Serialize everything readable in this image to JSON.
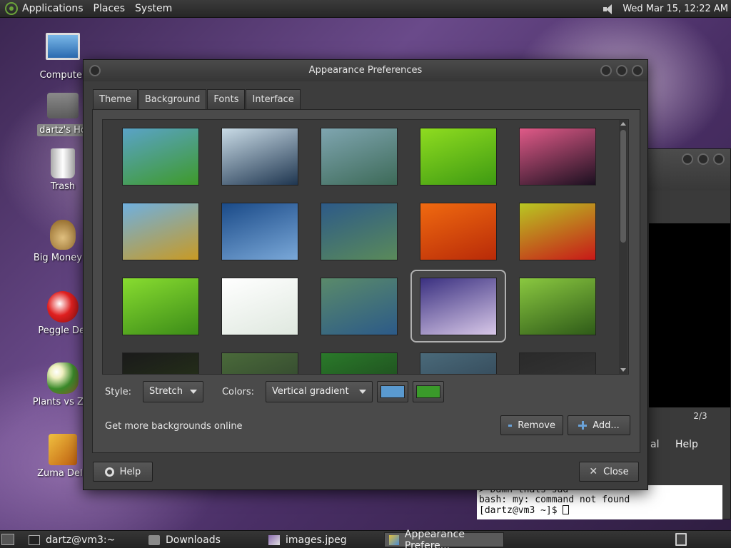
{
  "top_panel": {
    "menus": [
      "Applications",
      "Places",
      "System"
    ],
    "clock": "Wed Mar 15, 12:22 AM"
  },
  "desktop": {
    "icons": [
      {
        "label": "Computer",
        "icon": "computer-icon"
      },
      {
        "label": "dartz's Ho",
        "icon": "home-folder-icon"
      },
      {
        "label": "Trash",
        "icon": "trash-icon"
      },
      {
        "label": "Big Money D",
        "icon": "money-bag-icon"
      },
      {
        "label": "Peggle Del",
        "icon": "peggle-icon"
      },
      {
        "label": "Plants vs Zor",
        "icon": "plants-icon"
      },
      {
        "label": "Zuma Delu",
        "icon": "zuma-icon"
      }
    ]
  },
  "dialog": {
    "title": "Appearance Preferences",
    "tabs": [
      "Theme",
      "Background",
      "Fonts",
      "Interface"
    ],
    "active_tab": "Background",
    "wallpapers": [
      {
        "c1": "#5aa3c8",
        "c2": "#3e9a2a"
      },
      {
        "c1": "#c9dbe6",
        "c2": "#1f3650"
      },
      {
        "c1": "#7fa5b0",
        "c2": "#3d6a58"
      },
      {
        "c1": "#8fdc20",
        "c2": "#3e9a12"
      },
      {
        "c1": "#e05a88",
        "c2": "#1b1020"
      },
      {
        "c1": "#6fb0e0",
        "c2": "#c89a24"
      },
      {
        "c1": "#1a4a88",
        "c2": "#7aa8d8"
      },
      {
        "c1": "#2d5a88",
        "c2": "#5a8a5a"
      },
      {
        "c1": "#f06a10",
        "c2": "#b82a08"
      },
      {
        "c1": "#b8c822",
        "c2": "#c81818"
      },
      {
        "c1": "#88dc30",
        "c2": "#3c8c18"
      },
      {
        "c1": "#ffffff",
        "c2": "#dfe8df"
      },
      {
        "c1": "#5a8a6a",
        "c2": "#2c5a88"
      },
      {
        "c1": "#3a3080",
        "c2": "#d8c8e8"
      },
      {
        "c1": "#8ac840",
        "c2": "#2e5a18"
      },
      {
        "c1": "#1a1a1a",
        "c2": "#2a3a18"
      },
      {
        "c1": "#4a6a3a",
        "c2": "#2a3a2a"
      },
      {
        "c1": "#2a7a2a",
        "c2": "#1a3a1a"
      },
      {
        "c1": "#4a6a7a",
        "c2": "#2a3a4a"
      },
      {
        "c1": "#2a2a2a",
        "c2": "#3a3a3a"
      }
    ],
    "selected_index": 13,
    "style_label": "Style:",
    "style_value": "Stretch",
    "colors_label": "Colors:",
    "colors_value": "Vertical gradient",
    "primary_color": "#5a9ad0",
    "secondary_color": "#3a9a2a",
    "more_backgrounds": "Get more backgrounds online",
    "remove_label": "Remove",
    "add_label": "Add...",
    "help_label": "Help",
    "close_label": "Close"
  },
  "terminal": {
    "pager": "2/3",
    "menu_partial": "al",
    "menu_help": "Help",
    "lines": [
      "> Damn thats sad",
      "bash: my: command not found",
      "[dartz@vm3 ~]$ "
    ]
  },
  "taskbar": {
    "tasks": [
      {
        "label": "dartz@vm3:~",
        "icon": "terminal-icon"
      },
      {
        "label": "Downloads",
        "icon": "folder-icon"
      },
      {
        "label": "images.jpeg",
        "icon": "image-icon"
      },
      {
        "label": "Appearance Prefere...",
        "icon": "appearance-icon"
      }
    ]
  }
}
